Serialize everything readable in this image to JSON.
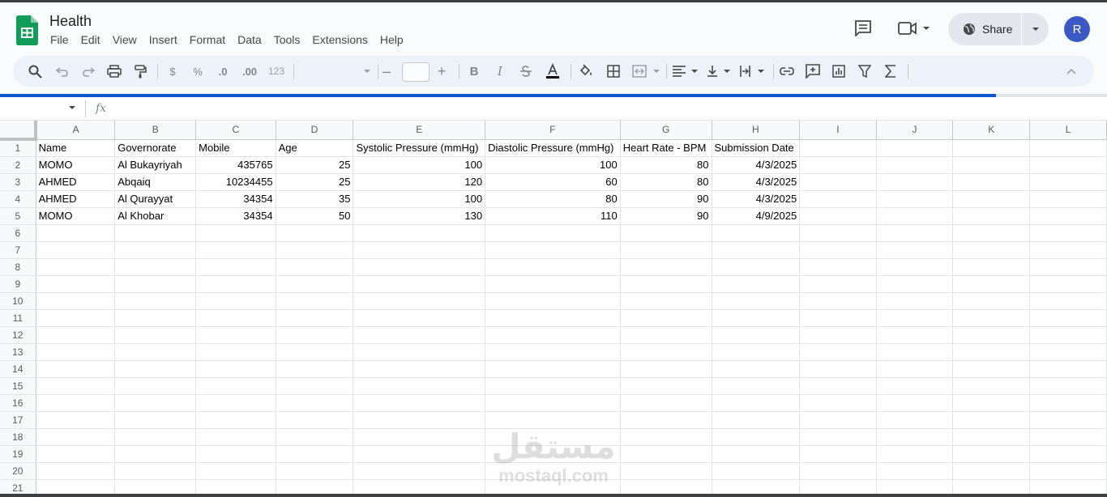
{
  "doc": {
    "title": "Health"
  },
  "menu": [
    "File",
    "Edit",
    "View",
    "Insert",
    "Format",
    "Data",
    "Tools",
    "Extensions",
    "Help"
  ],
  "share": {
    "label": "Share"
  },
  "avatar": {
    "initial": "R",
    "color": "#3b58c4"
  },
  "toolbar": {
    "currency": "$",
    "percent": "%",
    "dec_less": ".0",
    "dec_more": ".00",
    "num_format": "123",
    "minus": "–",
    "plus": "+",
    "bold": "B",
    "italic": "I"
  },
  "formula": {
    "fx": "fx"
  },
  "progress": {
    "fraction": 0.9
  },
  "columns": [
    "A",
    "B",
    "C",
    "D",
    "E",
    "F",
    "G",
    "H",
    "I",
    "J",
    "K",
    "L"
  ],
  "rows": [
    [
      "Name",
      "Governorate",
      "Mobile",
      "Age",
      "Systolic Pressure (mmHg)",
      "Diastolic Pressure (mmHg)",
      "Heart Rate - BPM",
      "Submission Date"
    ],
    [
      "MOMO",
      "Al Bukayriyah",
      "435765",
      "25",
      "100",
      "100",
      "80",
      "4/3/2025"
    ],
    [
      "AHMED",
      "Abqaiq",
      "10234455",
      "25",
      "120",
      "60",
      "80",
      "4/3/2025"
    ],
    [
      "AHMED",
      "Al Qurayyat",
      "34354",
      "35",
      "100",
      "80",
      "90",
      "4/3/2025"
    ],
    [
      "MOMO",
      "Al Khobar",
      "34354",
      "50",
      "130",
      "110",
      "90",
      "4/9/2025"
    ]
  ],
  "row_count": 21,
  "watermark": {
    "arabic": "مستقل",
    "latin": "mostaql.com"
  },
  "colors": {
    "accent": "#0b57d0",
    "sheets_green": "#0f9d58"
  }
}
